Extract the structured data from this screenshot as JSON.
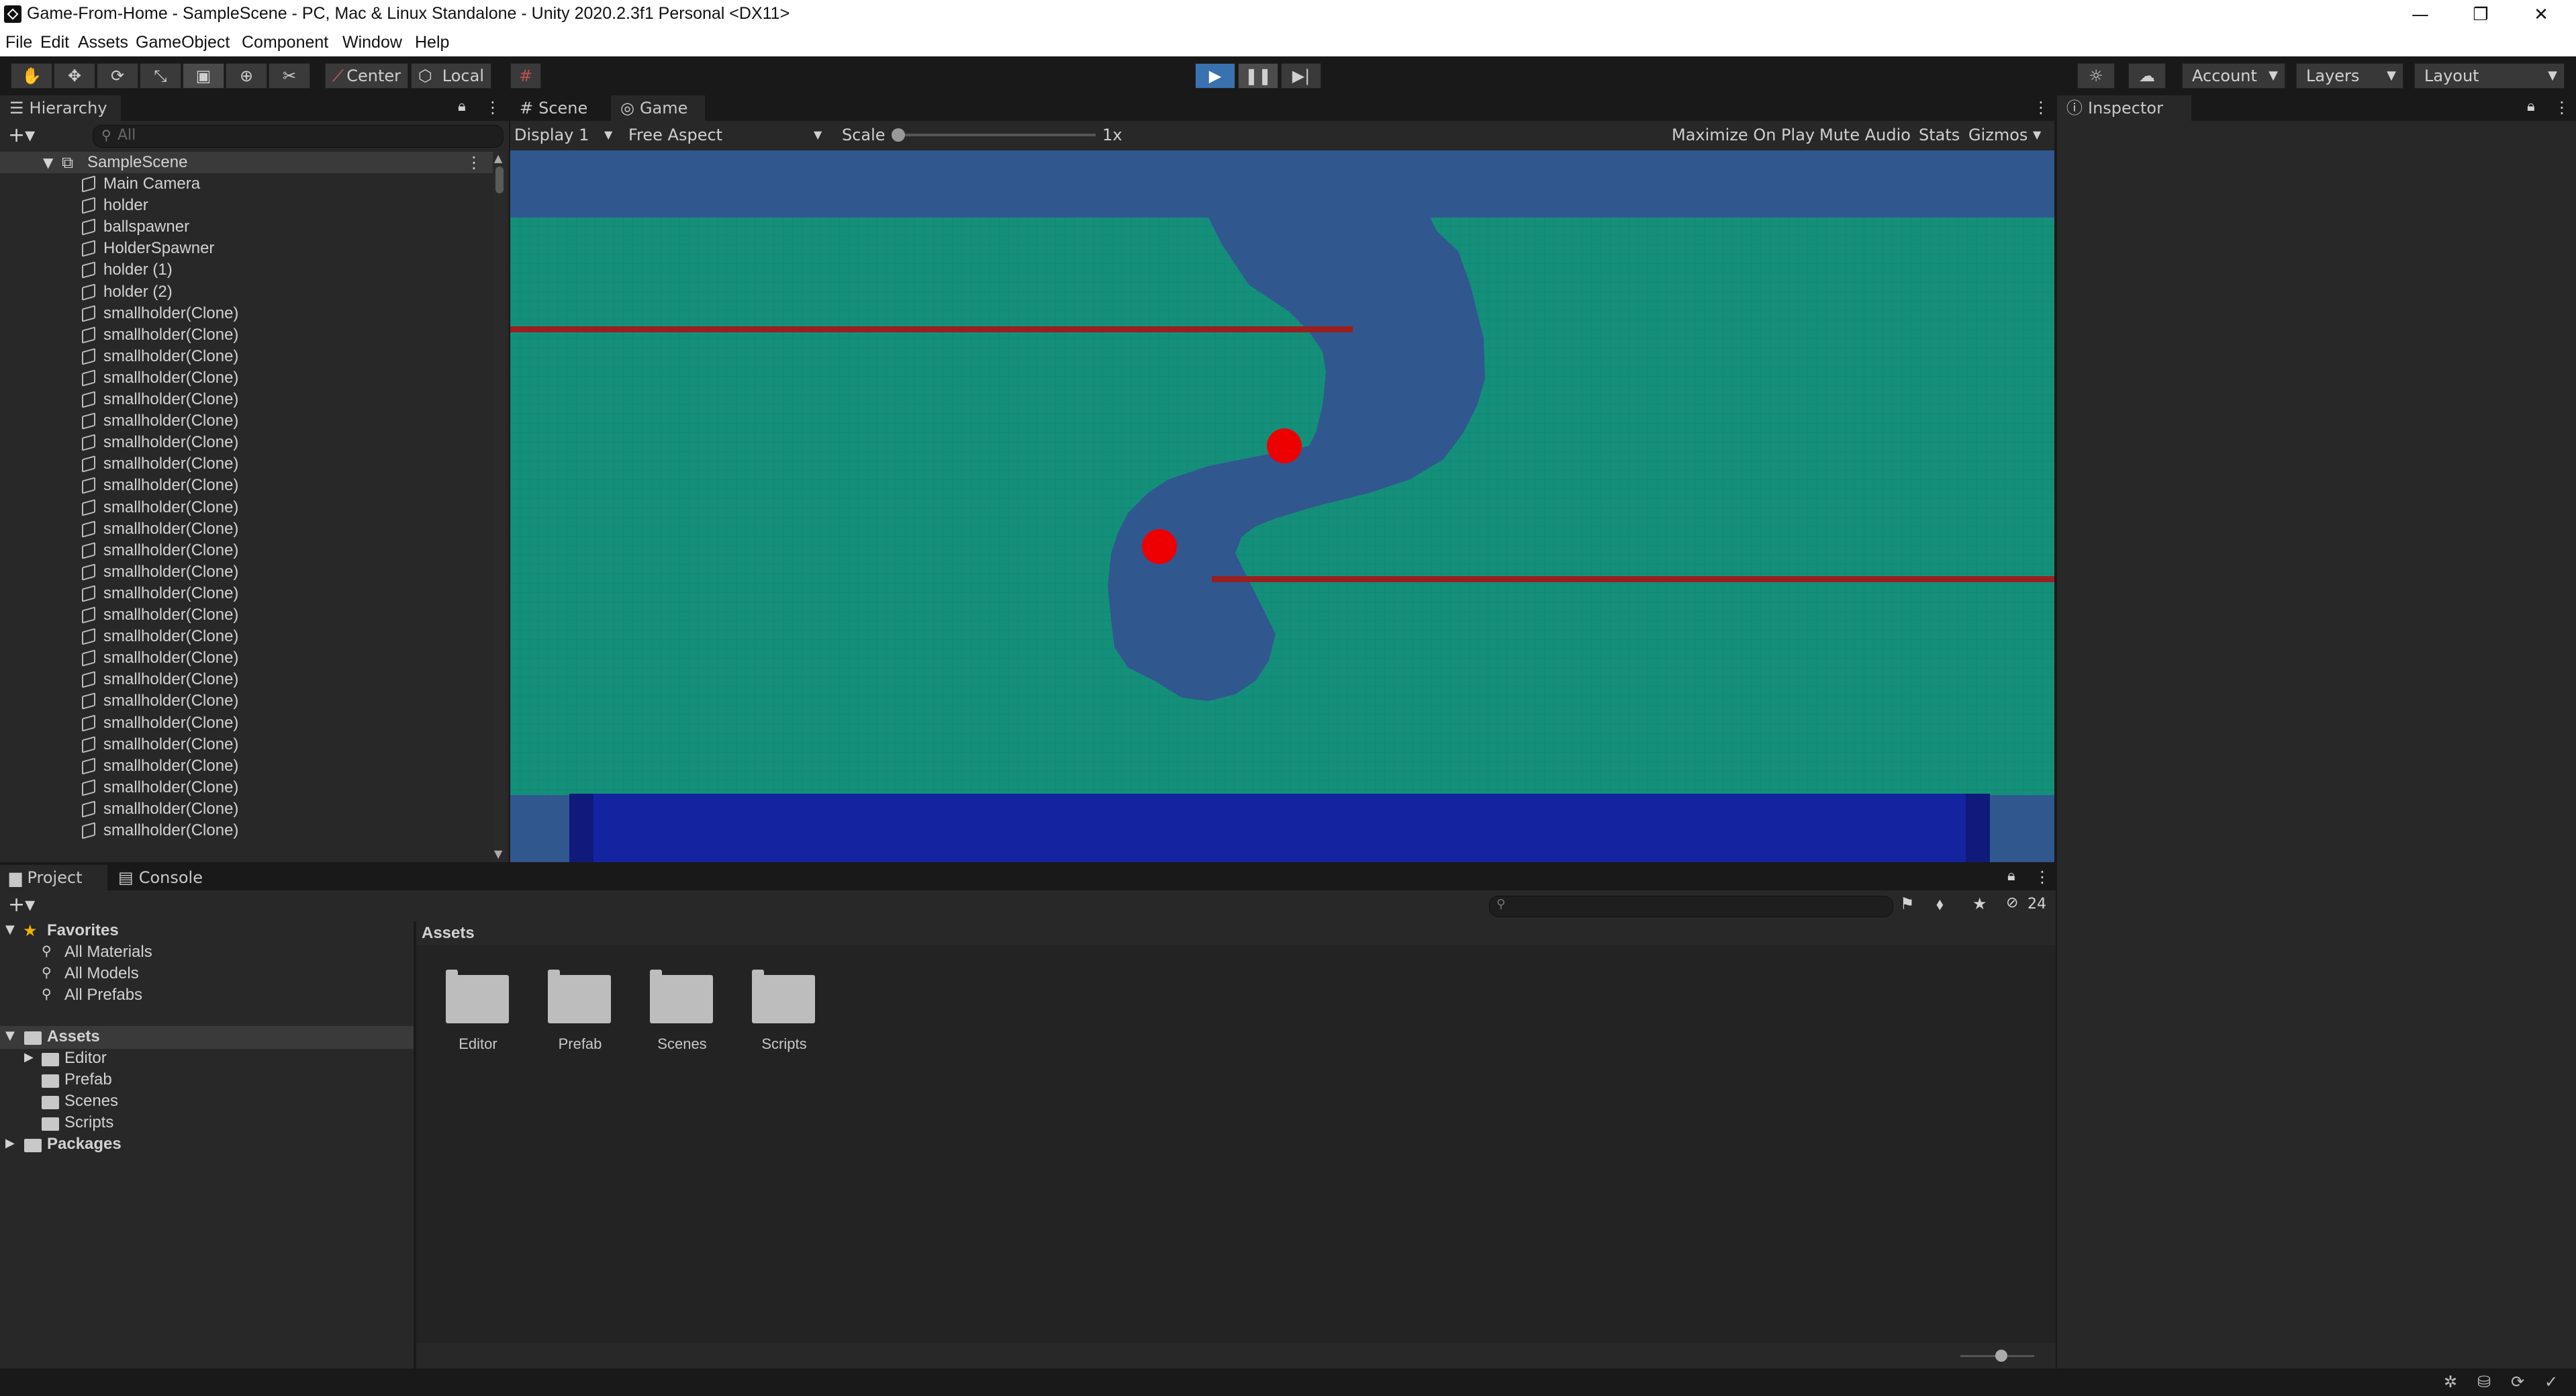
{
  "window": {
    "title": "Game-From-Home - SampleScene - PC, Mac & Linux Standalone - Unity 2020.2.3f1 Personal <DX11>",
    "minimize_glyph": "—",
    "restore_glyph": "❐",
    "close_glyph": "✕"
  },
  "menu": [
    "File",
    "Edit",
    "Assets",
    "GameObject",
    "Component",
    "Window",
    "Help"
  ],
  "toolbar": {
    "tools": [
      "hand-tool-icon",
      "move-tool-icon",
      "rotate-tool-icon",
      "scale-tool-icon",
      "rect-tool-icon",
      "transform-tool-icon",
      "custom-tool-icon"
    ],
    "pivot_label": "Center",
    "space_label": "Local",
    "account_label": "Account",
    "layers_label": "Layers",
    "layout_label": "Layout"
  },
  "hierarchy": {
    "tab_label": "Hierarchy",
    "search_placeholder": "All",
    "scene_name": "SampleScene",
    "items": [
      "Main Camera",
      "holder",
      "ballspawner",
      "HolderSpawner",
      "holder (1)",
      "holder (2)",
      "smallholder(Clone)",
      "smallholder(Clone)",
      "smallholder(Clone)",
      "smallholder(Clone)",
      "smallholder(Clone)",
      "smallholder(Clone)",
      "smallholder(Clone)",
      "smallholder(Clone)",
      "smallholder(Clone)",
      "smallholder(Clone)",
      "smallholder(Clone)",
      "smallholder(Clone)",
      "smallholder(Clone)",
      "smallholder(Clone)",
      "smallholder(Clone)",
      "smallholder(Clone)",
      "smallholder(Clone)",
      "smallholder(Clone)",
      "smallholder(Clone)",
      "smallholder(Clone)",
      "smallholder(Clone)",
      "smallholder(Clone)",
      "smallholder(Clone)",
      "smallholder(Clone)",
      "smallholder(Clone)"
    ]
  },
  "game_view": {
    "tabs": [
      "Scene",
      "Game"
    ],
    "display_label": "Display 1",
    "aspect_label": "Free Aspect",
    "scale_label": "Scale",
    "scale_value": "1x",
    "maximize_label": "Maximize On Play",
    "mute_label": "Mute Audio",
    "stats_label": "Stats",
    "gizmos_label": "Gizmos",
    "colors": {
      "sky": "#31578f",
      "ground": "#14907a",
      "tunnel": "#31578f",
      "bar": "#9b1f1f",
      "ball": "#ee0000",
      "floor": "#1424a0"
    }
  },
  "inspector": {
    "tab_label": "Inspector"
  },
  "project": {
    "tabs": [
      "Project",
      "Console"
    ],
    "hidden_count": "24",
    "favorites_label": "Favorites",
    "favorites": [
      "All Materials",
      "All Models",
      "All Prefabs"
    ],
    "assets_label": "Assets",
    "asset_folders": [
      "Editor",
      "Prefab",
      "Scenes",
      "Scripts"
    ],
    "packages_label": "Packages",
    "breadcrumb": "Assets",
    "grid_folders": [
      "Editor",
      "Prefab",
      "Scenes",
      "Scripts"
    ]
  }
}
